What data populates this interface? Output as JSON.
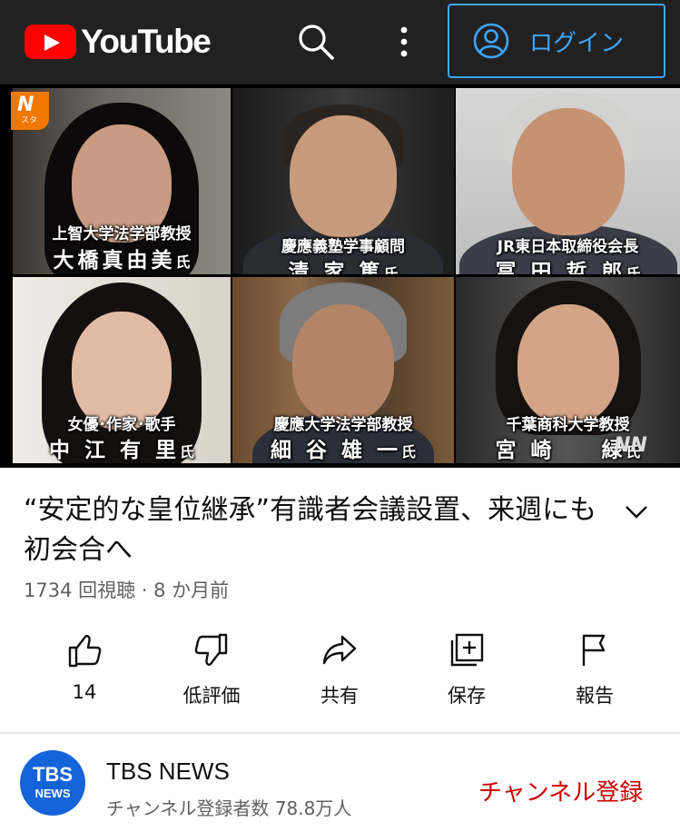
{
  "header": {
    "logo_text": "YouTube",
    "login_label": "ログイン"
  },
  "thumbnail": {
    "badge_top": "N",
    "badge_sub": "スタ",
    "watermark": "NN",
    "people": [
      {
        "title": "上智大学法学部教授",
        "name": "大橋真由美",
        "suffix": "氏"
      },
      {
        "title": "慶應義塾学事顧問",
        "name": "清 家 篤",
        "suffix": "氏"
      },
      {
        "title": "JR東日本取締役会長",
        "name": "冨 田 哲 郎",
        "suffix": "氏"
      },
      {
        "title": "女優･作家･歌手",
        "name": "中 江 有 里",
        "suffix": "氏"
      },
      {
        "title": "慶應大学法学部教授",
        "name": "細 谷 雄 一",
        "suffix": "氏"
      },
      {
        "title": "千葉商科大学教授",
        "name": "宮 崎 　 緑",
        "suffix": "氏"
      }
    ]
  },
  "video": {
    "title": "“安定的な皇位継承”有識者会議設置、来週にも初会合へ",
    "meta": "1734 回視聴 · 8 か月前"
  },
  "actions": [
    {
      "icon": "thumbs-up-icon",
      "label": "14"
    },
    {
      "icon": "thumbs-down-icon",
      "label": "低評価"
    },
    {
      "icon": "share-icon",
      "label": "共有"
    },
    {
      "icon": "save-icon",
      "label": "保存"
    },
    {
      "icon": "flag-icon",
      "label": "報告"
    }
  ],
  "channel": {
    "avatar_line1": "TBS",
    "avatar_line2": "NEWS",
    "name": "TBS NEWS",
    "subscribers": "チャンネル登録者数 78.8万人",
    "subscribe_label": "チャンネル登録"
  },
  "colors": {
    "topbar": "#212121",
    "accent_blue": "#3ea6ff",
    "youtube_red": "#ff0000",
    "subscribe_red": "#cc0000"
  }
}
